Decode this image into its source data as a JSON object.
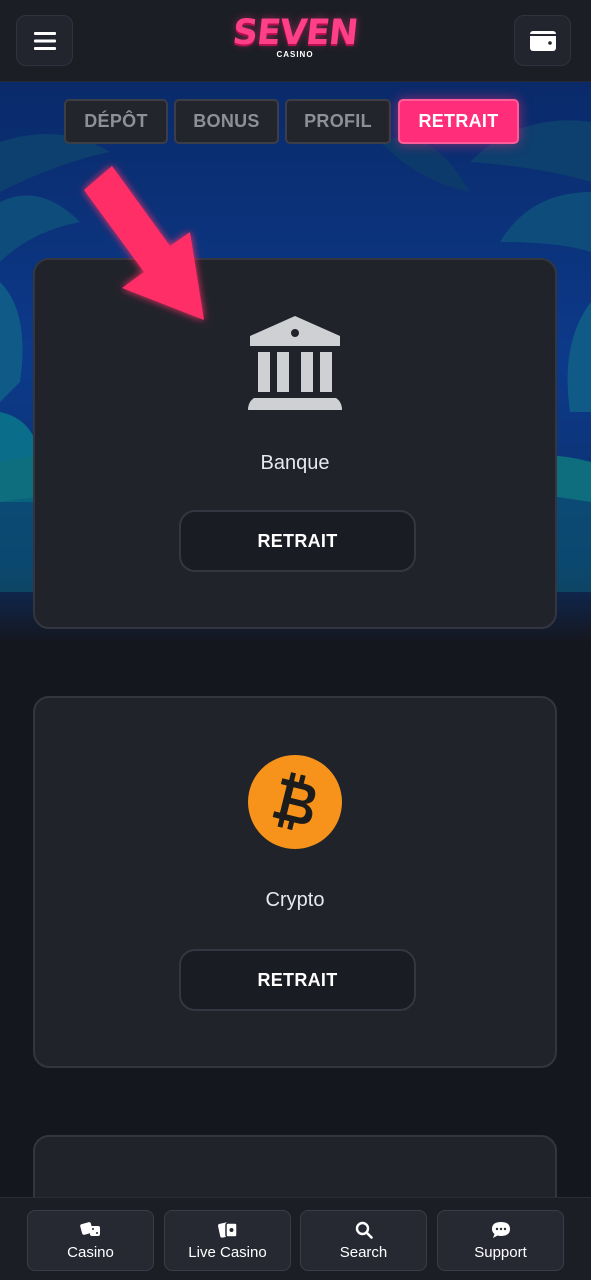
{
  "brand": {
    "logo_word": "SEVEN",
    "logo_sub": "CASINO",
    "accent": "#ff2d7a"
  },
  "header": {
    "menu_icon": "hamburger-menu-icon",
    "wallet_icon": "wallet-icon"
  },
  "tabs": [
    {
      "label": "DÉPÔT",
      "active": false
    },
    {
      "label": "BONUS",
      "active": false
    },
    {
      "label": "PROFIL",
      "active": false
    },
    {
      "label": "RETRAIT",
      "active": true
    }
  ],
  "methods": [
    {
      "label": "Banque",
      "icon": "bank-icon",
      "button": "RETRAIT"
    },
    {
      "label": "Crypto",
      "icon": "bitcoin-icon",
      "button": "RETRAIT"
    }
  ],
  "bottom_nav": [
    {
      "label": "Casino",
      "icon": "dice-icon"
    },
    {
      "label": "Live Casino",
      "icon": "cards-icon"
    },
    {
      "label": "Search",
      "icon": "search-icon"
    },
    {
      "label": "Support",
      "icon": "chat-bubble-icon"
    }
  ],
  "colors": {
    "background": "#15171f",
    "card": "#21232b",
    "bitcoin": "#f7931a",
    "arrow": "#ff2d66"
  }
}
